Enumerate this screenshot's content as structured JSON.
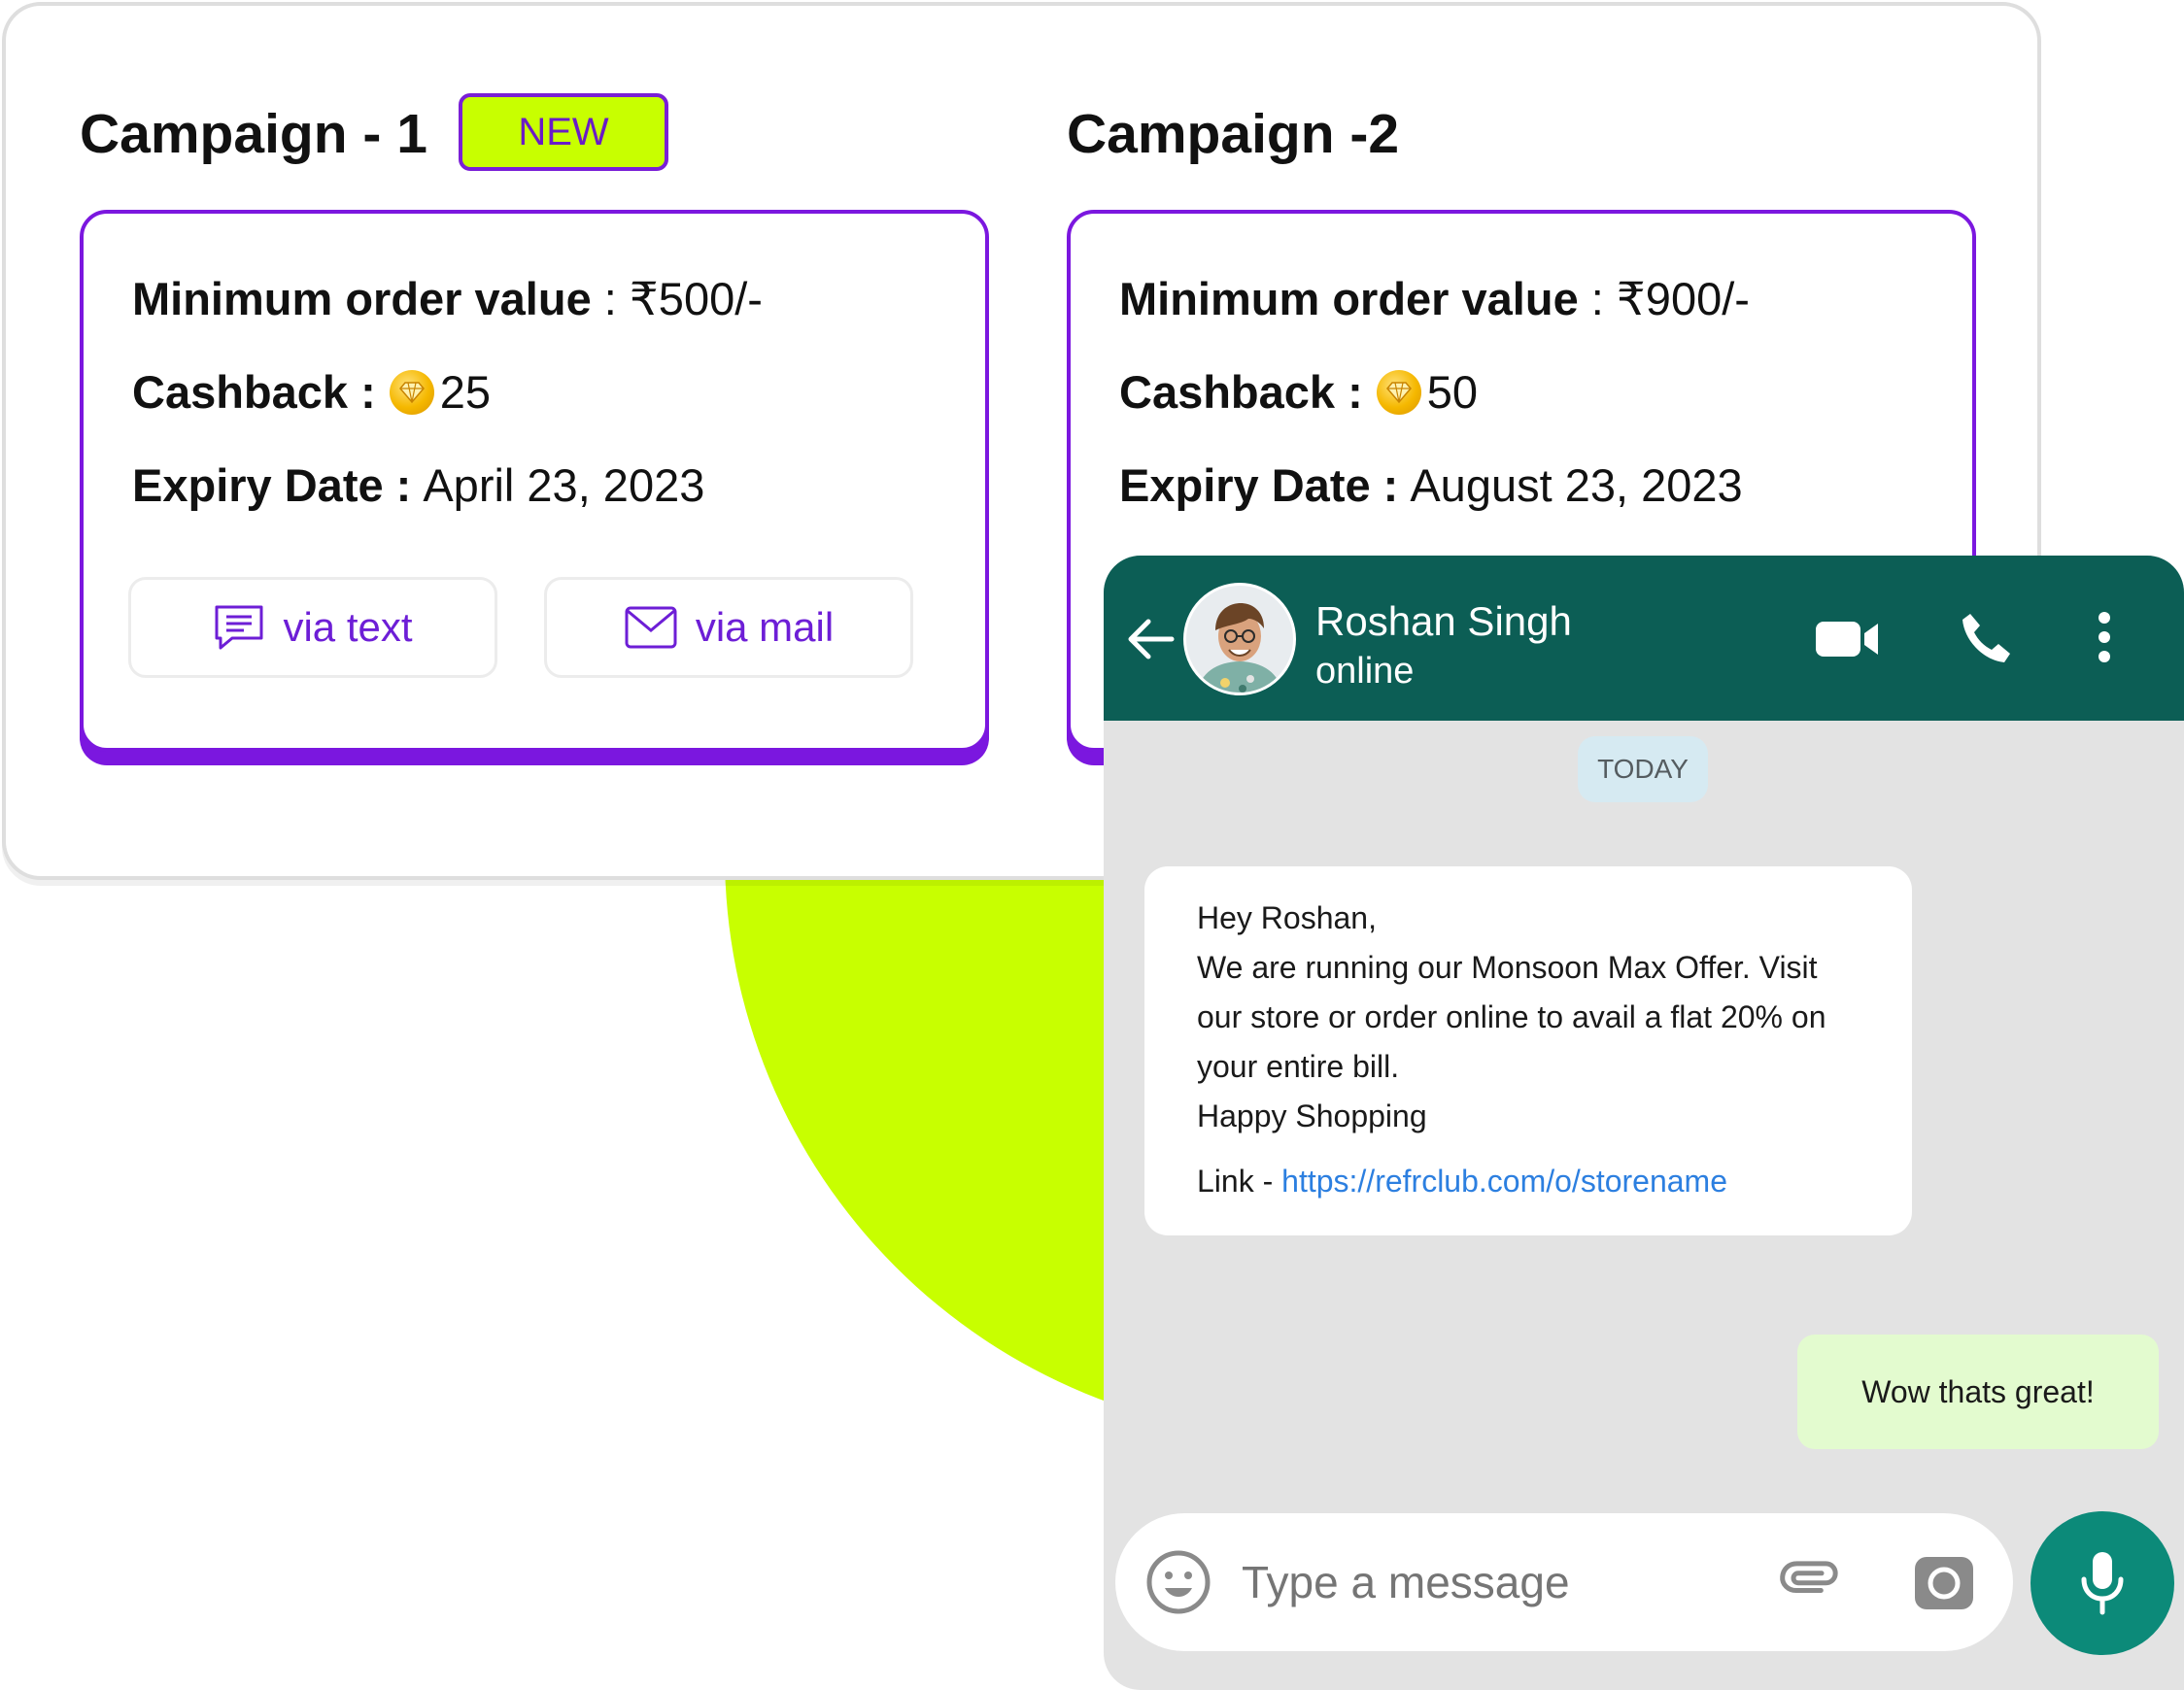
{
  "campaigns": [
    {
      "title": "Campaign - 1",
      "badge": "NEW",
      "min_order_label": "Minimum order value",
      "min_order_sep": " : ",
      "min_order_value": "₹500/-",
      "cashback_label": "Cashback :",
      "cashback_value": "25",
      "expiry_label": "Expiry Date :",
      "expiry_value": "April 23, 2023",
      "text_button": "via text",
      "mail_button": "via mail"
    },
    {
      "title": "Campaign -2",
      "min_order_label": "Minimum order value",
      "min_order_sep": " : ",
      "min_order_value": "₹900/-",
      "cashback_label": "Cashback :",
      "cashback_value": "50",
      "expiry_label": "Expiry Date :",
      "expiry_value": "August 23, 2023"
    }
  ],
  "chat": {
    "contact_name": "Roshan Singh",
    "status": "online",
    "date_divider": "TODAY",
    "incoming": {
      "lines": [
        "Hey Roshan,",
        "We are running our Monsoon Max Offer. Visit",
        "our store or order online to avail a flat 20% on",
        "your entire bill.",
        "Happy Shopping"
      ],
      "link_label": "Link - ",
      "link_url": "https://refrclub.com/o/storename"
    },
    "outgoing": "Wow thats great!",
    "input_placeholder": "Type a message"
  },
  "colors": {
    "accent_purple": "#7b17df",
    "lime": "#c8ff00",
    "header_green": "#0c5e55",
    "mic_green": "#0c8a79",
    "outgoing_bubble": "#e3fbcf"
  },
  "icons": [
    "chat-text-icon",
    "mail-icon",
    "coin-icon",
    "back-arrow-icon",
    "video-call-icon",
    "phone-icon",
    "more-vertical-icon",
    "emoji-icon",
    "attach-icon",
    "camera-icon",
    "mic-icon"
  ]
}
